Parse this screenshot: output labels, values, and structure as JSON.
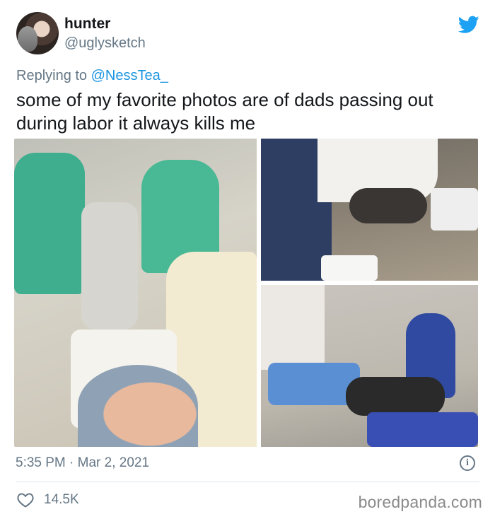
{
  "author": {
    "display_name": "hunter",
    "handle": "@uglysketch"
  },
  "reply": {
    "prefix": "Replying to ",
    "mention": "@NessTea_"
  },
  "tweet": {
    "text": "some of my favorite photos are of dads passing out during labor it always kills me"
  },
  "meta": {
    "timestamp": "5:35 PM · Mar 2, 2021",
    "likes": "14.5K"
  },
  "watermark": "boredpanda.com",
  "icons": {
    "platform": "twitter-bird-icon",
    "info": "info-icon",
    "like": "heart-icon"
  },
  "colors": {
    "brand_blue": "#1da1f2",
    "mention_blue": "#1b95e0",
    "secondary_text": "#657786",
    "primary_text": "#14171a"
  }
}
